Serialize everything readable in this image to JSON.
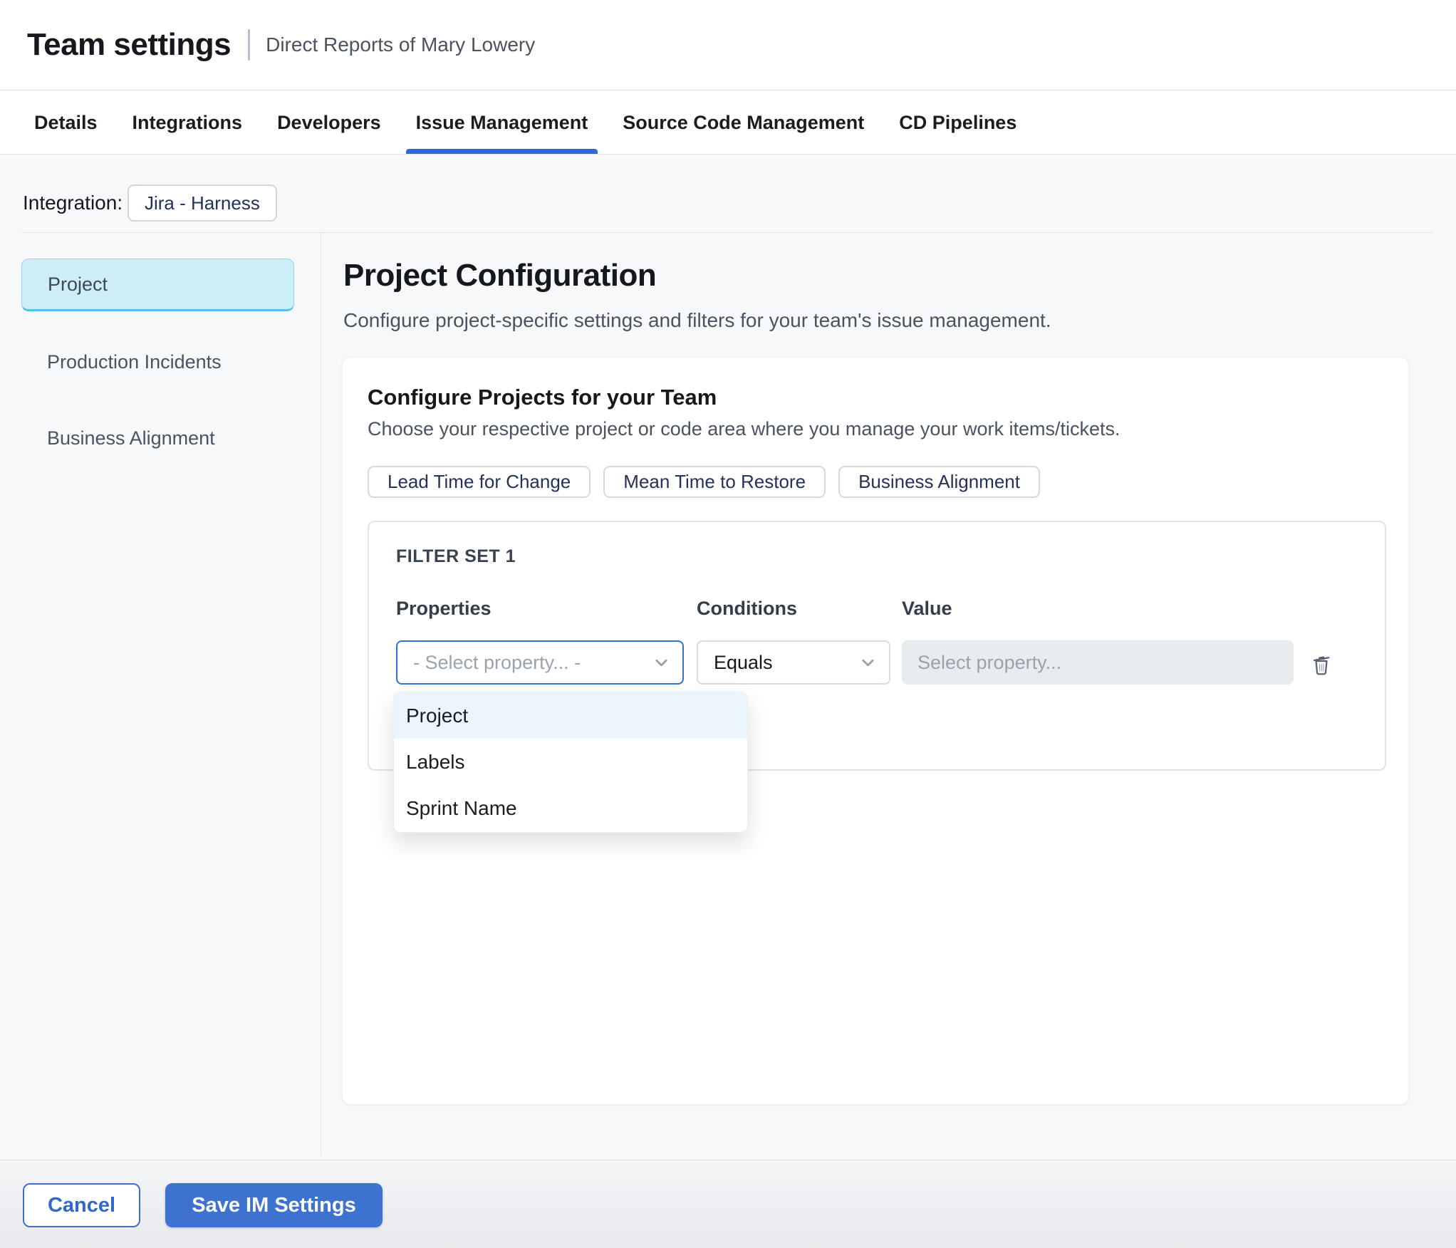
{
  "header": {
    "title": "Team settings",
    "subtitle": "Direct Reports of Mary Lowery"
  },
  "tabs": [
    {
      "label": "Details",
      "active": false
    },
    {
      "label": "Integrations",
      "active": false
    },
    {
      "label": "Developers",
      "active": false
    },
    {
      "label": "Issue Management",
      "active": true
    },
    {
      "label": "Source Code Management",
      "active": false
    },
    {
      "label": "CD Pipelines",
      "active": false
    }
  ],
  "integration": {
    "label": "Integration:",
    "value": "Jira - Harness"
  },
  "sidebar": {
    "items": [
      {
        "label": "Project",
        "active": true
      },
      {
        "label": "Production Incidents",
        "active": false
      },
      {
        "label": "Business Alignment",
        "active": false
      }
    ]
  },
  "main": {
    "heading": "Project Configuration",
    "description": "Configure project-specific settings and filters for your team's issue management.",
    "card": {
      "title": "Configure Projects for your Team",
      "description": "Choose your respective project or code area where you manage your work items/tickets.",
      "metric_tabs": [
        {
          "label": "Lead Time for Change"
        },
        {
          "label": "Mean Time to Restore"
        },
        {
          "label": "Business Alignment"
        }
      ],
      "filter_set": {
        "title": "FILTER SET 1",
        "properties_label": "Properties",
        "conditions_label": "Conditions",
        "value_label": "Value",
        "properties_placeholder": "- Select property... -",
        "condition_selected": "Equals",
        "value_placeholder": "Select property..."
      },
      "property_dropdown": {
        "options": [
          {
            "label": "Project",
            "highlighted": true
          },
          {
            "label": "Labels",
            "highlighted": false
          },
          {
            "label": "Sprint Name",
            "highlighted": false
          }
        ]
      }
    }
  },
  "footer": {
    "cancel_label": "Cancel",
    "save_label": "Save IM Settings"
  },
  "colors": {
    "accent_blue": "#3069d6",
    "save_button_blue": "#3d72d1",
    "selected_sidebar_cyan": "#cdeef9",
    "dropdown_highlight": "#eaf6fb",
    "properties_border_blue": "#2e72d2"
  }
}
